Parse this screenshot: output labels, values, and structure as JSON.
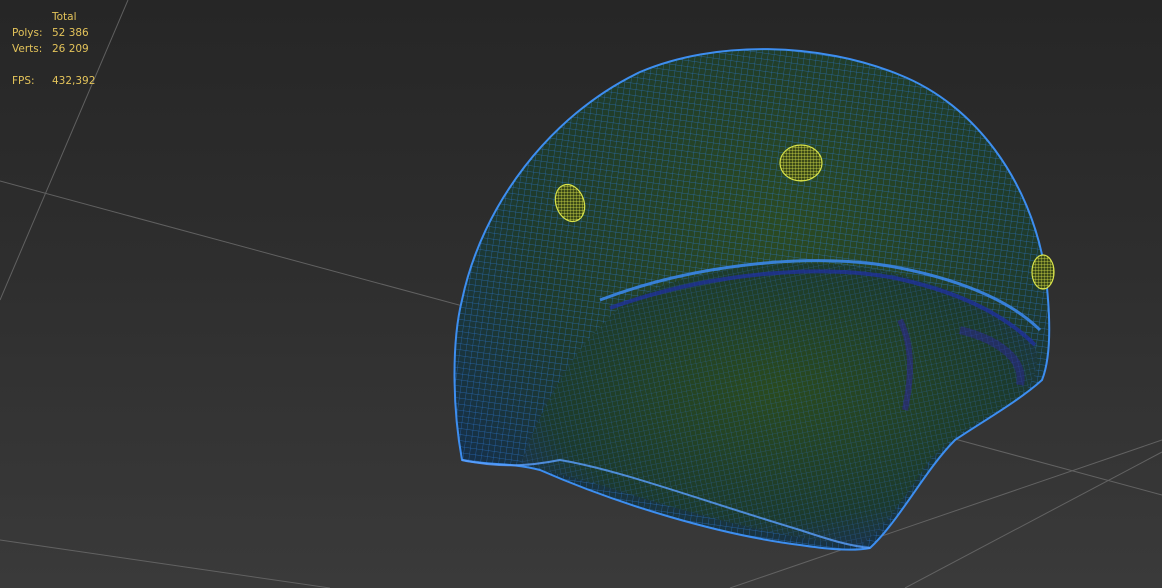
{
  "viewport": {
    "background_color": "#2b2b2b",
    "grid_color": "#6a6a6a",
    "mesh_fill_color": "#1f3a26",
    "wire_color": "#2c7de0",
    "helper_wire_color": "#c9d445"
  },
  "statistics": {
    "column_header": "Total",
    "polys_label": "Polys:",
    "polys_value": "52 386",
    "verts_label": "Verts:",
    "verts_value": "26 209",
    "fps_label": "FPS:",
    "fps_value": "432,392",
    "text_color": "#e3c35a"
  }
}
